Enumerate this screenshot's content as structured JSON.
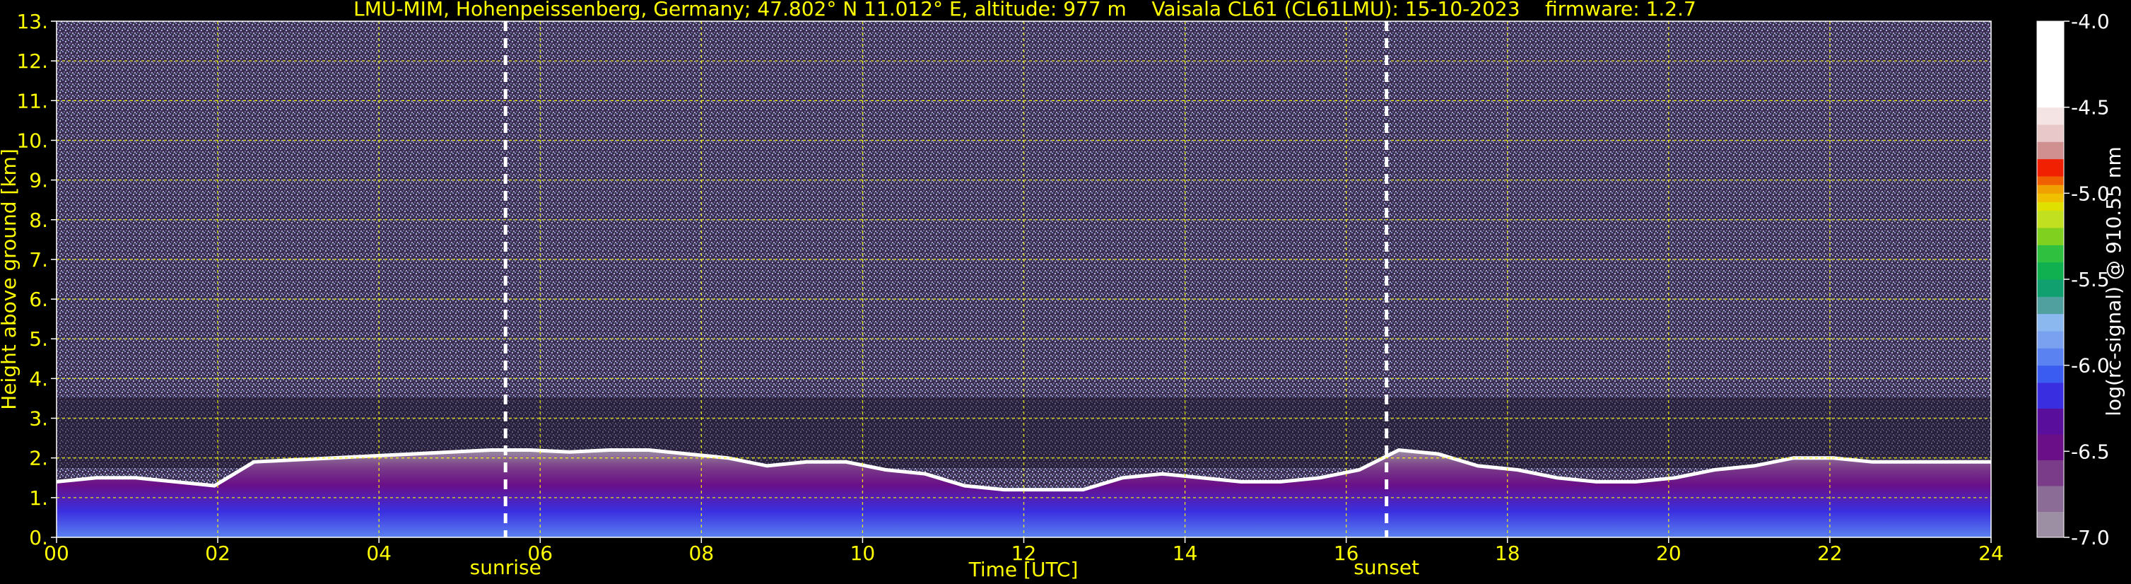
{
  "chart_data": {
    "type": "heatmap",
    "title": "LMU-MIM, Hohenpeissenberg, Germany; 47.802° N 11.012° E, altitude: 977 m    Vaisala CL61 (CL61LMU): 15-10-2023    firmware: 1.2.7",
    "xlabel": "Time [UTC]",
    "ylabel": "Height above ground [km]",
    "xlim": [
      0,
      24
    ],
    "ylim": [
      0,
      13
    ],
    "x_ticks": [
      "00",
      "02",
      "04",
      "06",
      "08",
      "10",
      "12",
      "14",
      "16",
      "18",
      "20",
      "22",
      "24"
    ],
    "y_ticks": [
      "0.",
      "1.",
      "2.",
      "3.",
      "4.",
      "5.",
      "6.",
      "7.",
      "8.",
      "9.",
      "10.",
      "11.",
      "12.",
      "13."
    ],
    "grid": true,
    "grid_color": "#ffff00",
    "events": [
      {
        "label": "sunrise",
        "time": 5.57
      },
      {
        "label": "sunset",
        "time": 16.5
      }
    ],
    "colorbar": {
      "label": "log(rc-signal) @ 910.55 nm",
      "range": [
        -7.0,
        -4.0
      ],
      "ticks": [
        "-4.0",
        "-4.5",
        "-5.0",
        "-5.5",
        "-6.0",
        "-6.5",
        "-7.0"
      ],
      "colors": [
        "#9c8ea3",
        "#8a6c96",
        "#7a3c88",
        "#6a0f88",
        "#5a0f9c",
        "#3a2fe0",
        "#3b5cf0",
        "#5a82f0",
        "#7aa0f0",
        "#8cb8f0",
        "#50a0a0",
        "#10a070",
        "#10b050",
        "#30c040",
        "#80d020",
        "#c0e020",
        "#e0e000",
        "#f0c000",
        "#f0a000",
        "#f06000",
        "#f02000",
        "#d09090",
        "#e8c8c8",
        "#f4e4e4",
        "#ffffff"
      ],
      "color_stops": [
        -7.0,
        -6.85,
        -6.7,
        -6.55,
        -6.4,
        -6.25,
        -6.1,
        -6.0,
        -5.9,
        -5.8,
        -5.7,
        -5.6,
        -5.5,
        -5.4,
        -5.3,
        -5.2,
        -5.1,
        -5.05,
        -5.0,
        -4.95,
        -4.9,
        -4.8,
        -4.7,
        -4.6,
        -4.5
      ]
    },
    "layers": [
      {
        "name": "aerosol-layer",
        "top_km": [
          1.4,
          1.5,
          1.5,
          1.4,
          1.3,
          1.9,
          1.95,
          2.0,
          2.05,
          2.1,
          2.15,
          2.2,
          2.2,
          2.15,
          2.2,
          2.2,
          2.1,
          2.0,
          1.8,
          1.9,
          1.9,
          1.7,
          1.6,
          1.3,
          1.2,
          1.2,
          1.2,
          1.5,
          1.6,
          1.5,
          1.4,
          1.4,
          1.5,
          1.7,
          2.2,
          2.1,
          1.8,
          1.7,
          1.5,
          1.4,
          1.4,
          1.5,
          1.7,
          1.8,
          2.0,
          2.0,
          1.9,
          1.9,
          1.9,
          1.9
        ]
      }
    ]
  }
}
